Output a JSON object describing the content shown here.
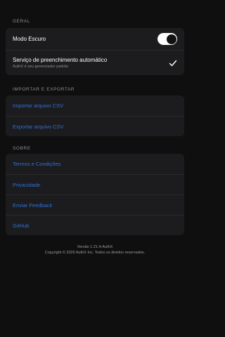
{
  "sections": {
    "general": {
      "header": "GERAL",
      "dark_mode_label": "Modo Escuro",
      "dark_mode_on": true,
      "autofill_label": "Serviço de preenchimento automático",
      "autofill_sub": "AuthX é seu gerenciador padrão"
    },
    "import_export": {
      "header": "IMPORTAR E EXPORTAR",
      "import_label": "Importar arquivo CSV",
      "export_label": "Exportar arquivo CSV"
    },
    "about": {
      "header": "SOBRE",
      "items": [
        "Termos e Condições",
        "Privacidade",
        "Enviar Feedback",
        "GitHub"
      ]
    }
  },
  "footer": {
    "version": "Versão 1.21.4-AuthX",
    "copyright": "Copyright © 2025 AuthX Inc. Todos os direitos reservados."
  },
  "colors": {
    "background": "#0f0f0f",
    "card": "#1c1c1e",
    "link": "#2f6fd6",
    "muted": "#8e8e93"
  }
}
